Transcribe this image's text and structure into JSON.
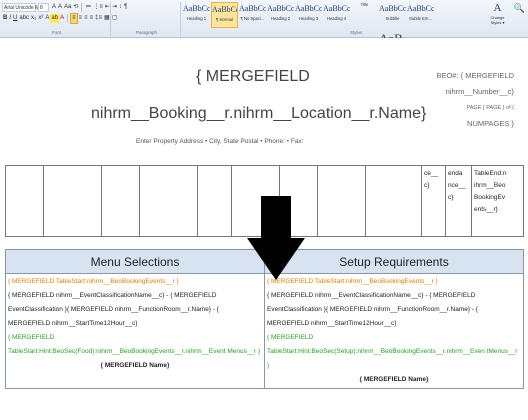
{
  "ribbon": {
    "font_name": "Arial Unicode M",
    "font_size": "8",
    "row1_icons": [
      "A",
      "A",
      "Aa",
      "⟲",
      "≔",
      "⋮≡",
      "⇤",
      "⇥",
      "↕",
      "¶"
    ],
    "row2_icons": [
      "B",
      "I",
      "U",
      "abc",
      "x₂",
      "x²",
      "A",
      "ab",
      "A",
      "≡",
      "≡",
      "≡",
      "≡",
      "‡≡",
      "▦",
      "▢"
    ],
    "groups": {
      "font": "Font",
      "paragraph": "Paragraph",
      "styles": "Styles"
    },
    "styles": [
      {
        "sample": "AaBbCc",
        "name": "Heading 1",
        "active": false
      },
      {
        "sample": "AaBbCcDc",
        "name": "¶ Normal",
        "active": true
      },
      {
        "sample": "AaBbCcDc",
        "name": "¶ No Spaci...",
        "active": false
      },
      {
        "sample": "AaBbCc",
        "name": "Heading 2",
        "active": false
      },
      {
        "sample": "AaBbCcl",
        "name": "Heading 3",
        "active": false
      },
      {
        "sample": "AaBbCcl",
        "name": "Heading 4",
        "active": false
      },
      {
        "sample": "AaB",
        "name": "Title",
        "active": false
      },
      {
        "sample": "AaBbCc.",
        "name": "Subtitle",
        "active": false
      },
      {
        "sample": "AaBbCcl",
        "name": "Subtle Em...",
        "active": false
      }
    ],
    "change_styles": {
      "icon": "A",
      "label": "Change Styles ▾"
    },
    "edit_icon": "🔍"
  },
  "document": {
    "title": "{ MERGEFIELD",
    "subtitle": "nihrm__Booking__r.nihrm__Location__r.Name}",
    "address": "Enter Property Address  •  City, State Postal  •  Phone:  •  Fax:",
    "beo": {
      "line1": "BEO#:  { MERGEFIELD",
      "line2": "nihrm__Number__c}",
      "line3": "PAGE { PAGE } of {",
      "line4": "NUMPAGES  }"
    },
    "info_cells": [
      "",
      "",
      "",
      "",
      "",
      "",
      "",
      "",
      "",
      "ce__ c}",
      "enda nce__ c}",
      "TableEnd:n ihrm__Beo BookingEv ents__r}"
    ],
    "menu": {
      "header": "Menu Selections",
      "tablestart": "{ MERGEFIELD  TableStart:nihrm__BeoBookingEvents__r }",
      "body": "{ MERGEFIELD nihrm__EventClassificationName__c} - { MERGEFIELD EventClassification }{ MERGEFIELD nihrm__FunctionRoom__r.Name} - { MERGEFIELD nihrm__StartTime12Hour__c}",
      "mf": "{ MERGEFIELD",
      "hint": "TableStart:Hint:BeoSec(Food):nihrm__BeoBookingEvents__r.nihrm__Event Menus__r }",
      "name": "{ MERGEFIELD Name}"
    },
    "setup": {
      "header": "Setup Requirements",
      "tablestart": "{ MERGEFIELD  TableStart:nihrm__BeoBookingEvents__r }",
      "body": "{ MERGEFIELD nihrm__EventClassificationName__c} - { MERGEFIELD EventClassification }{ MERGEFIELD nihrm__FunctionRoom__r.Name} - { MERGEFIELD nihrm__StartTime12Hour__c}",
      "mf": "{ MERGEFIELD",
      "hint": "TableStart:Hint:BeoSec(Setup):nihrm__BeoBookingEvents__r.nihrm__Even tMenus__r }",
      "name": "{ MERGEFIELD Name}"
    }
  },
  "colors": {
    "merge_orange": "#e67e00",
    "merge_green": "#2a9d2a",
    "header_fill": "#d8e3f1",
    "arrow": "#000000"
  }
}
